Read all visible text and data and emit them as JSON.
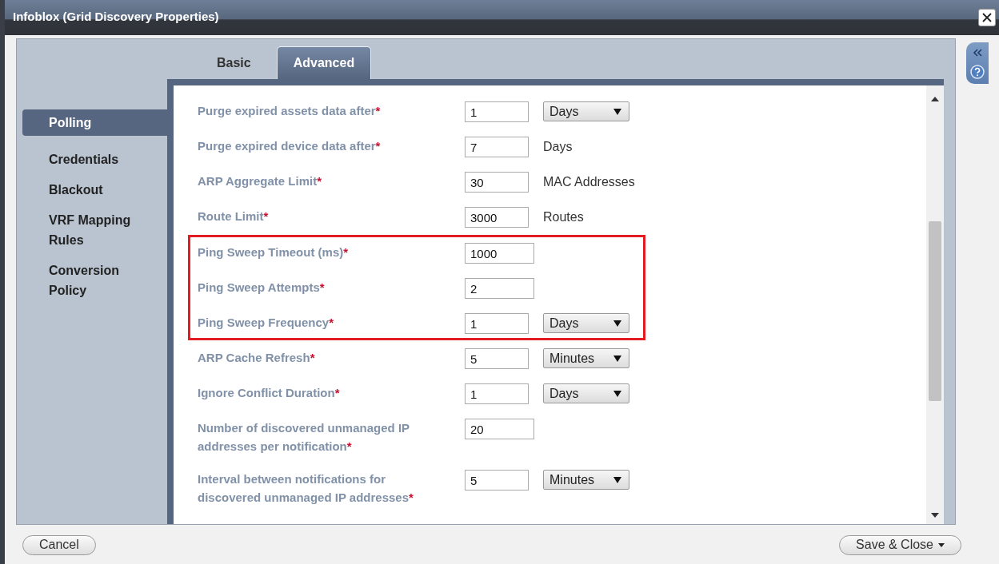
{
  "window": {
    "title": "Infoblox (Grid Discovery Properties)"
  },
  "tabs": [
    {
      "label": "Basic",
      "selected": false
    },
    {
      "label": "Advanced",
      "selected": true
    }
  ],
  "sidebar": {
    "items": [
      {
        "label": "Polling",
        "selected": true
      },
      {
        "label": "Credentials",
        "selected": false
      },
      {
        "label": "Blackout",
        "selected": false
      },
      {
        "label": "VRF Mapping Rules",
        "selected": false
      },
      {
        "label": "Conversion Policy",
        "selected": false
      }
    ]
  },
  "fields": [
    {
      "label": "Purge expired assets data after",
      "required_mark": "*",
      "value": "1",
      "unit": {
        "kind": "select",
        "text": "Days"
      },
      "highlighted": false
    },
    {
      "label": "Purge expired device data after",
      "required_mark": "*",
      "value": "7",
      "unit": {
        "kind": "text",
        "text": "Days"
      },
      "highlighted": false
    },
    {
      "label": "ARP Aggregate Limit",
      "required_mark": "*",
      "value": "30",
      "unit": {
        "kind": "text",
        "text": "MAC Addresses"
      },
      "highlighted": false
    },
    {
      "label": "Route Limit",
      "required_mark": "*",
      "value": "3000",
      "unit": {
        "kind": "text",
        "text": "Routes"
      },
      "highlighted": false
    },
    {
      "label": "Ping Sweep Timeout (ms)",
      "required_mark": "*",
      "value": "1000",
      "highlighted": true
    },
    {
      "label": "Ping Sweep Attempts",
      "required_mark": "*",
      "value": "2",
      "highlighted": true
    },
    {
      "label": "Ping Sweep Frequency",
      "required_mark": "*",
      "value": "1",
      "unit": {
        "kind": "select",
        "text": "Days"
      },
      "highlighted": true
    },
    {
      "label": "ARP Cache Refresh",
      "required_mark": "*",
      "value": "5",
      "unit": {
        "kind": "select",
        "text": "Minutes"
      },
      "highlighted": false
    },
    {
      "label": "Ignore Conflict Duration",
      "required_mark": "*",
      "value": "1",
      "unit": {
        "kind": "select",
        "text": "Days"
      },
      "highlighted": false
    },
    {
      "label": "Number of discovered unmanaged IP addresses per notification",
      "required_mark": "*",
      "value": "20",
      "highlighted": false
    },
    {
      "label": "Interval between notifications for discovered unmanaged IP addresses",
      "required_mark": "*",
      "value": "5",
      "unit": {
        "kind": "select",
        "text": "Minutes"
      },
      "highlighted": false
    }
  ],
  "footer": {
    "buttons": [
      {
        "label": "Cancel",
        "kind": "plain"
      },
      {
        "label": "Save & Close",
        "kind": "menu"
      }
    ]
  }
}
